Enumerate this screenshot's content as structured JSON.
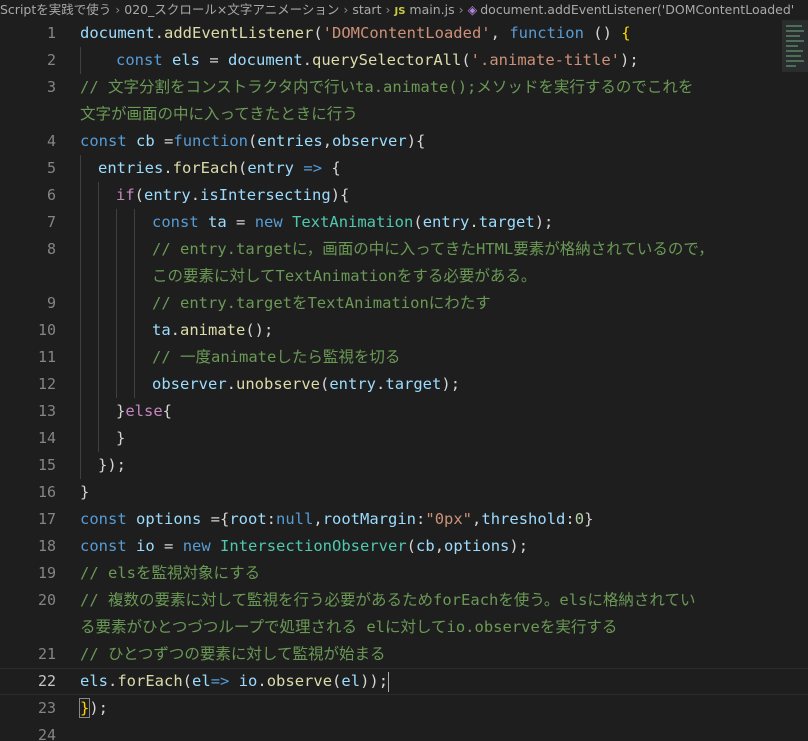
{
  "breadcrumb": {
    "items": [
      "Scriptを実践で使う",
      "020_スクロール×文字アニメーション",
      "start",
      "main.js",
      "document.addEventListener('DOMContentLoaded'"
    ],
    "js_icon": "JS",
    "symbol_icon": "cube-icon"
  },
  "editor": {
    "current_line": "22",
    "lines": [
      {
        "num": "1",
        "indent": 0,
        "guides": [],
        "tokens": [
          [
            "var",
            "document"
          ],
          [
            "pun",
            "."
          ],
          [
            "fn",
            "addEventListener"
          ],
          [
            "pun",
            "("
          ],
          [
            "str",
            "'DOMContentLoaded'"
          ],
          [
            "pun",
            ", "
          ],
          [
            "kw",
            "function"
          ],
          [
            "pun",
            " () "
          ],
          [
            "br",
            "{"
          ]
        ]
      },
      {
        "num": "2",
        "indent": 2,
        "guides": [
          80
        ],
        "tokens": [
          [
            "kw",
            "const"
          ],
          [
            "pun",
            " "
          ],
          [
            "var",
            "els"
          ],
          [
            "pun",
            " = "
          ],
          [
            "var",
            "document"
          ],
          [
            "pun",
            "."
          ],
          [
            "fn",
            "querySelectorAll"
          ],
          [
            "pun",
            "("
          ],
          [
            "str",
            "'.animate-title'"
          ],
          [
            "pun",
            ");"
          ]
        ]
      },
      {
        "num": "3",
        "indent": 0,
        "guides": [],
        "tokens": [
          [
            "cmt",
            "// 文字分割をコンストラクタ内で行いta.animate();メソッドを実行するのでこれを"
          ]
        ]
      },
      {
        "num": "",
        "indent": 0,
        "guides": [],
        "tokens": [
          [
            "cmt",
            "文字が画面の中に入ってきたときに行う"
          ]
        ]
      },
      {
        "num": "4",
        "indent": 0,
        "guides": [],
        "tokens": [
          [
            "kw",
            "const"
          ],
          [
            "pun",
            " "
          ],
          [
            "var",
            "cb"
          ],
          [
            "pun",
            " ="
          ],
          [
            "kw",
            "function"
          ],
          [
            "pun",
            "("
          ],
          [
            "var",
            "entries"
          ],
          [
            "pun",
            ","
          ],
          [
            "var",
            "observer"
          ],
          [
            "pun",
            "){"
          ]
        ]
      },
      {
        "num": "5",
        "indent": 1,
        "guides": [
          80
        ],
        "tokens": [
          [
            "var",
            "entries"
          ],
          [
            "pun",
            "."
          ],
          [
            "fn",
            "forEach"
          ],
          [
            "pun",
            "("
          ],
          [
            "var",
            "entry"
          ],
          [
            "pun",
            " "
          ],
          [
            "kw",
            "=>"
          ],
          [
            "pun",
            " {"
          ]
        ]
      },
      {
        "num": "6",
        "indent": 2,
        "guides": [
          80,
          98
        ],
        "tokens": [
          [
            "ctl",
            "if"
          ],
          [
            "pun",
            "("
          ],
          [
            "var",
            "entry"
          ],
          [
            "pun",
            "."
          ],
          [
            "var",
            "isIntersecting"
          ],
          [
            "pun",
            "){"
          ]
        ]
      },
      {
        "num": "7",
        "indent": 4,
        "guides": [
          80,
          98,
          116,
          134
        ],
        "tokens": [
          [
            "kw",
            "const"
          ],
          [
            "pun",
            " "
          ],
          [
            "var",
            "ta"
          ],
          [
            "pun",
            " = "
          ],
          [
            "kw",
            "new"
          ],
          [
            "pun",
            " "
          ],
          [
            "cls",
            "TextAnimation"
          ],
          [
            "pun",
            "("
          ],
          [
            "var",
            "entry"
          ],
          [
            "pun",
            "."
          ],
          [
            "var",
            "target"
          ],
          [
            "pun",
            ");"
          ]
        ]
      },
      {
        "num": "8",
        "indent": 4,
        "guides": [
          80,
          98,
          116,
          134
        ],
        "tokens": [
          [
            "cmt",
            "// entry.targetに，画面の中に入ってきたHTML要素が格納されているので，"
          ]
        ]
      },
      {
        "num": "",
        "indent": 4,
        "guides": [
          80,
          98,
          116,
          134
        ],
        "tokens": [
          [
            "cmt",
            "この要素に対してTextAnimationをする必要がある。"
          ]
        ]
      },
      {
        "num": "9",
        "indent": 4,
        "guides": [
          80,
          98,
          116,
          134
        ],
        "tokens": [
          [
            "cmt",
            "// entry.targetをTextAnimationにわたす"
          ]
        ]
      },
      {
        "num": "10",
        "indent": 4,
        "guides": [
          80,
          98,
          116,
          134
        ],
        "tokens": [
          [
            "var",
            "ta"
          ],
          [
            "pun",
            "."
          ],
          [
            "fn",
            "animate"
          ],
          [
            "pun",
            "();"
          ]
        ]
      },
      {
        "num": "11",
        "indent": 4,
        "guides": [
          80,
          98,
          116,
          134
        ],
        "tokens": [
          [
            "cmt",
            "// 一度animateしたら監視を切る"
          ]
        ]
      },
      {
        "num": "12",
        "indent": 4,
        "guides": [
          80,
          98,
          116,
          134
        ],
        "tokens": [
          [
            "var",
            "observer"
          ],
          [
            "pun",
            "."
          ],
          [
            "fn",
            "unobserve"
          ],
          [
            "pun",
            "("
          ],
          [
            "var",
            "entry"
          ],
          [
            "pun",
            "."
          ],
          [
            "var",
            "target"
          ],
          [
            "pun",
            ");"
          ]
        ]
      },
      {
        "num": "13",
        "indent": 2,
        "guides": [
          80,
          98
        ],
        "tokens": [
          [
            "pun",
            "}"
          ],
          [
            "ctl",
            "else"
          ],
          [
            "pun",
            "{"
          ]
        ]
      },
      {
        "num": "14",
        "indent": 2,
        "guides": [
          80,
          98
        ],
        "tokens": [
          [
            "pun",
            "}"
          ]
        ]
      },
      {
        "num": "15",
        "indent": 1,
        "guides": [
          80
        ],
        "tokens": [
          [
            "pun",
            "});"
          ]
        ]
      },
      {
        "num": "16",
        "indent": 0,
        "guides": [],
        "tokens": [
          [
            "pun",
            "}"
          ]
        ]
      },
      {
        "num": "17",
        "indent": 0,
        "guides": [],
        "tokens": [
          [
            "kw",
            "const"
          ],
          [
            "pun",
            " "
          ],
          [
            "var",
            "options"
          ],
          [
            "pun",
            " ={"
          ],
          [
            "var",
            "root"
          ],
          [
            "pun",
            ":"
          ],
          [
            "kw",
            "null"
          ],
          [
            "pun",
            ","
          ],
          [
            "var",
            "rootMargin"
          ],
          [
            "pun",
            ":"
          ],
          [
            "str",
            "\"0px\""
          ],
          [
            "pun",
            ","
          ],
          [
            "var",
            "threshold"
          ],
          [
            "pun",
            ":"
          ],
          [
            "num",
            "0"
          ],
          [
            "pun",
            "}"
          ]
        ]
      },
      {
        "num": "18",
        "indent": 0,
        "guides": [],
        "tokens": [
          [
            "kw",
            "const"
          ],
          [
            "pun",
            " "
          ],
          [
            "var",
            "io"
          ],
          [
            "pun",
            " = "
          ],
          [
            "kw",
            "new"
          ],
          [
            "pun",
            " "
          ],
          [
            "cls",
            "IntersectionObserver"
          ],
          [
            "pun",
            "("
          ],
          [
            "var",
            "cb"
          ],
          [
            "pun",
            ","
          ],
          [
            "var",
            "options"
          ],
          [
            "pun",
            ");"
          ]
        ]
      },
      {
        "num": "19",
        "indent": 0,
        "guides": [],
        "tokens": [
          [
            "cmt",
            "// elsを監視対象にする"
          ]
        ]
      },
      {
        "num": "20",
        "indent": 0,
        "guides": [],
        "tokens": [
          [
            "cmt",
            "// 複数の要素に対して監視を行う必要があるためforEachを使う。elsに格納されてい"
          ]
        ]
      },
      {
        "num": "",
        "indent": 0,
        "guides": [],
        "tokens": [
          [
            "cmt",
            "る要素がひとつづつループで処理される elに対してio.observeを実行する"
          ]
        ]
      },
      {
        "num": "21",
        "indent": 0,
        "guides": [],
        "tokens": [
          [
            "cmt",
            "// ひとつずつの要素に対して監視が始まる"
          ]
        ]
      },
      {
        "num": "22",
        "indent": 0,
        "guides": [],
        "cursor": true,
        "tokens": [
          [
            "var",
            "els"
          ],
          [
            "pun",
            "."
          ],
          [
            "fn",
            "forEach"
          ],
          [
            "pun",
            "("
          ],
          [
            "var",
            "el"
          ],
          [
            "kw",
            "=>"
          ],
          [
            "pun",
            " "
          ],
          [
            "var",
            "io"
          ],
          [
            "pun",
            "."
          ],
          [
            "fn",
            "observe"
          ],
          [
            "pun",
            "("
          ],
          [
            "var",
            "el"
          ],
          [
            "pun",
            "));"
          ]
        ]
      },
      {
        "num": "23",
        "indent": 0,
        "guides": [],
        "tokens": [
          [
            "brbox",
            "}"
          ],
          [
            "pun",
            ");"
          ]
        ]
      },
      {
        "num": "24",
        "indent": 0,
        "guides": [],
        "tokens": []
      }
    ]
  },
  "colors": {
    "background": "#1e1e1e",
    "line_number": "#858585",
    "comment": "#6a9955",
    "keyword": "#569cd6",
    "string": "#ce9178",
    "function": "#dcdcaa",
    "variable": "#9cdcfe",
    "class": "#4ec9b0"
  }
}
